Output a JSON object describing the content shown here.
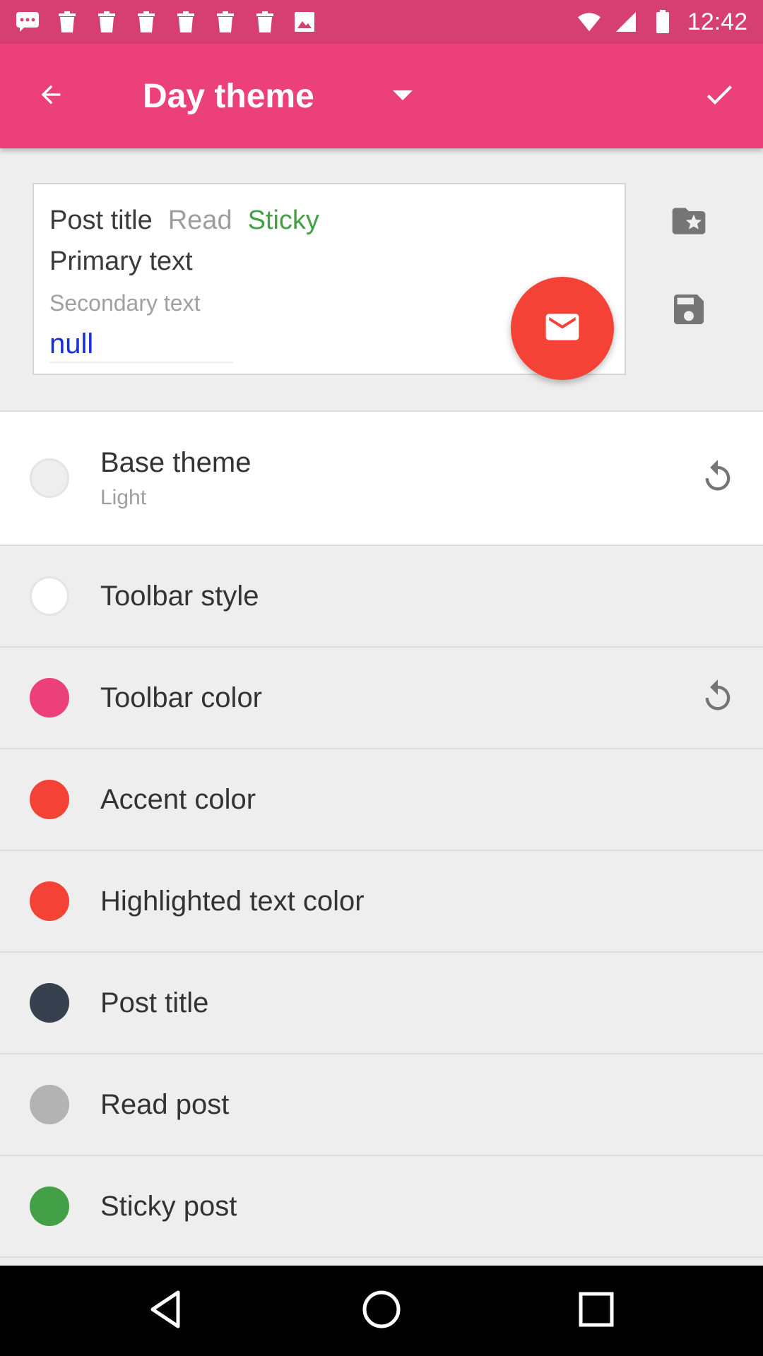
{
  "status_bar": {
    "time": "12:42"
  },
  "toolbar": {
    "title": "Day theme"
  },
  "preview": {
    "post_title": "Post title",
    "read": "Read",
    "sticky": "Sticky",
    "primary_text": "Primary text",
    "secondary_text": "Secondary text",
    "link_text": "null"
  },
  "settings": [
    {
      "label": "Base theme",
      "sublabel": "Light",
      "color": "#eeeeee",
      "resettable": true
    },
    {
      "label": "Toolbar style",
      "color": "#ffffff",
      "resettable": false
    },
    {
      "label": "Toolbar color",
      "color": "#ec407a",
      "resettable": true
    },
    {
      "label": "Accent color",
      "color": "#f44336",
      "resettable": false
    },
    {
      "label": "Highlighted text color",
      "color": "#f44336",
      "resettable": false
    },
    {
      "label": "Post title",
      "color": "#37404f",
      "resettable": false
    },
    {
      "label": "Read post",
      "color": "#b3b3b3",
      "resettable": false
    },
    {
      "label": "Sticky post",
      "color": "#43a047",
      "resettable": false
    }
  ],
  "colors": {
    "status_bar": "#d63f72",
    "toolbar": "#ec407a",
    "fab": "#f44336",
    "icon_grey": "#757575"
  },
  "icons": {
    "back": "arrow-back-icon",
    "dropdown": "arrow-drop-down-icon",
    "confirm": "check-icon",
    "folder": "folder-star-icon",
    "save": "floppy-save-icon",
    "fab": "mail-icon",
    "reset": "refresh-icon"
  }
}
